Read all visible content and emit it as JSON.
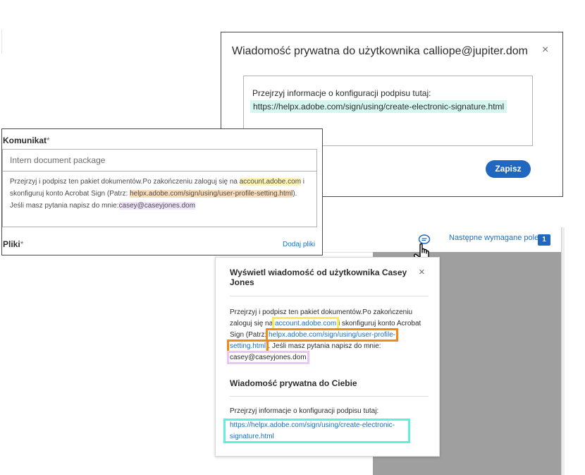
{
  "private_dialog": {
    "title": "Wiadomość prywatna do użytkownika calliope@jupiter.dom",
    "close_icon": "×",
    "line1": "Przejrzyj informacje o konfiguracji podpisu tutaj:",
    "line2": "https://helpx.adobe.com/sign/using/create-electronic-signature.html",
    "save_label": "Zapisz"
  },
  "message_card": {
    "label": "Komunikat",
    "required_mark": "*",
    "subject": "Intern document package",
    "body_part1": "Przejrzyj i podpisz ten pakiet dokumentów.Po zakończeniu zaloguj się na ",
    "body_link1": "account.adobe.com",
    "body_part2": " i skonfiguruj konto Acrobat Sign (Patrz: ",
    "body_link2": "helpx.adobe.com/sign/using/user-profile-setting.html",
    "body_part3": "). Jeśli masz pytania napisz do mnie:",
    "body_email": "casey@caseyjones.dom",
    "files_label": "Pliki",
    "add_files": "Dodaj pliki"
  },
  "app": {
    "next_required_field": "Następne wymagane pole",
    "next_count": "1"
  },
  "view_popup": {
    "title": "Wyświetl wiadomość od użytkownika Casey Jones",
    "close_icon": "×",
    "text1": "Przejrzyj i podpisz ten pakiet dokumentów.Po zakończeniu zaloguj się na ",
    "link1": "account.adobe.com",
    "text2": " i skonfiguruj konto Acrobat Sign (Patrz: ",
    "link2a": "helpx.adobe.com/sign/using/user-profile-",
    "link2b": "setting.html",
    "text3": "). Jeśli masz pytania napisz do mnie: ",
    "email": "casey@caseyjones.dom",
    "private_heading": "Wiadomość prywatna do Ciebie",
    "private_text": "Przejrzyj informacje o konfiguracji podpisu tutaj:",
    "private_link": "https://helpx.adobe.com/sign/using/create-electronic-signature.html"
  },
  "colors": {
    "accent": "#1f67bf",
    "highlight_yellow": "#f7ec5a",
    "highlight_orange": "#f08c16",
    "highlight_purple": "#e8c7f7",
    "highlight_teal": "#5ff0dc"
  },
  "icons": [
    "close-icon",
    "chat-bubble-icon",
    "hand-cursor-icon"
  ]
}
